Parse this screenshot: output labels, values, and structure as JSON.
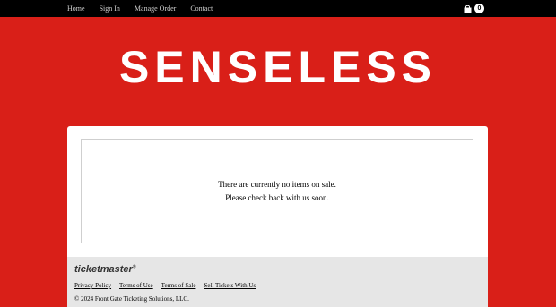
{
  "nav": {
    "home": "Home",
    "sign_in": "Sign In",
    "manage_order": "Manage Order",
    "contact": "Contact"
  },
  "cart": {
    "icon": "shopping-bag-icon",
    "count": "0"
  },
  "logo": {
    "text": "SENSELESS"
  },
  "main": {
    "message_line1": "There are currently no items on sale.",
    "message_line2": "Please check back with us soon."
  },
  "footer": {
    "brand": "ticketmaster",
    "links": [
      "Privacy Policy",
      "Terms of Use",
      "Terms of Sale",
      "Sell Tickets With Us"
    ],
    "copyright": "© 2024 Front Gate Ticketing Solutions, LLC."
  },
  "colors": {
    "background": "#d91f18",
    "topbar": "#000000",
    "footer": "#e6e6e6"
  }
}
